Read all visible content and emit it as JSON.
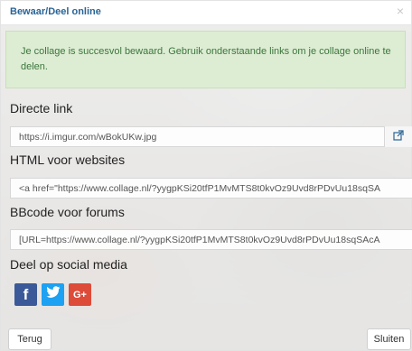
{
  "modal": {
    "title": "Bewaar/Deel online",
    "close_symbol": "×"
  },
  "alert": {
    "message": "Je collage is succesvol bewaard. Gebruik onderstaande links om je collage online te delen."
  },
  "direct_link": {
    "label": "Directe link",
    "value": "https://i.imgur.com/wBokUKw.jpg",
    "icon": "external-link-icon"
  },
  "html_code": {
    "label": "HTML voor websites",
    "value": "<a href=\"https://www.collage.nl/?yygpKSi20tfP1MvMTS8t0kvOz9Uvd8rPDvUu18sqSA"
  },
  "bbcode": {
    "label": "BBcode voor forums",
    "value": "[URL=https://www.collage.nl/?yygpKSi20tfP1MvMTS8t0kvOz9Uvd8rPDvUu18sqSAcA"
  },
  "social": {
    "label": "Deel op social media",
    "facebook": "f",
    "google_plus": "G+"
  },
  "footer": {
    "back_label": "Terug",
    "close_label": "Sluiten"
  }
}
